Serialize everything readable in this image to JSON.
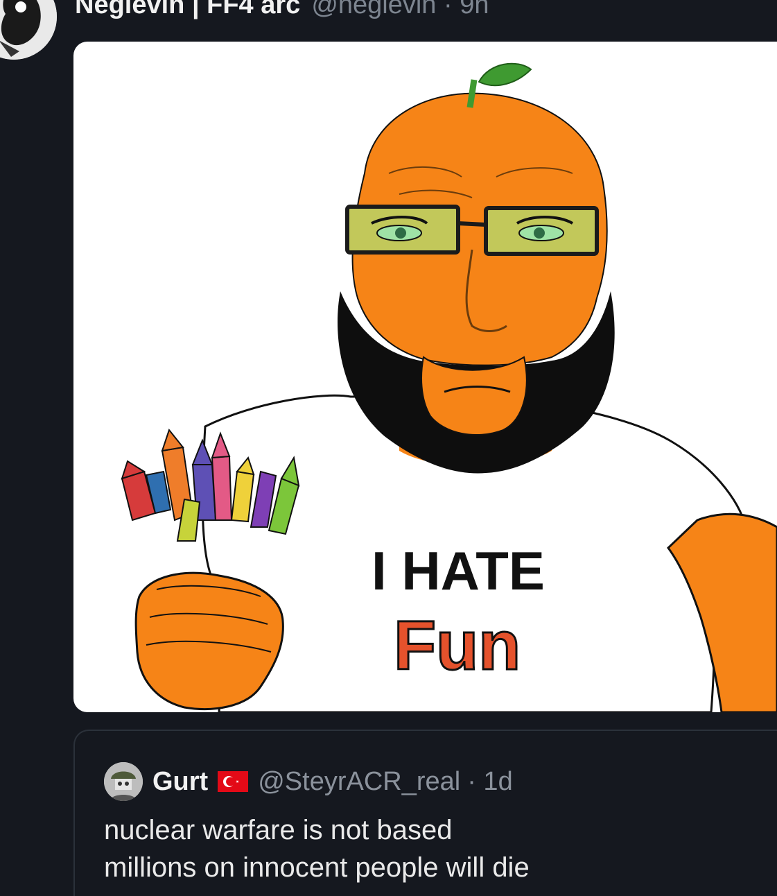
{
  "tweet": {
    "display_name": "Neglevin | FF4 arc",
    "handle": "@neglevin",
    "time": "· 9h",
    "avatar_icon": "avatar-icon"
  },
  "media": {
    "shirt_line1": "I HATE",
    "shirt_line2": "Fun",
    "palette": {
      "skin": "#f68417",
      "beard": "#0e0e0e",
      "leaf": "#3f9a31",
      "lens": "#c2c85a"
    }
  },
  "quote": {
    "display_name": "Gurt",
    "flag_icon": "turkey-flag-icon",
    "handle": "@SteyrACR_real",
    "time": "· 1d",
    "lines": [
      "nuclear warfare is not based",
      "millions on innocent people will die"
    ]
  },
  "colors": {
    "background": "#15181f",
    "text_primary": "#f1f1f1",
    "text_secondary": "#7d8590"
  }
}
